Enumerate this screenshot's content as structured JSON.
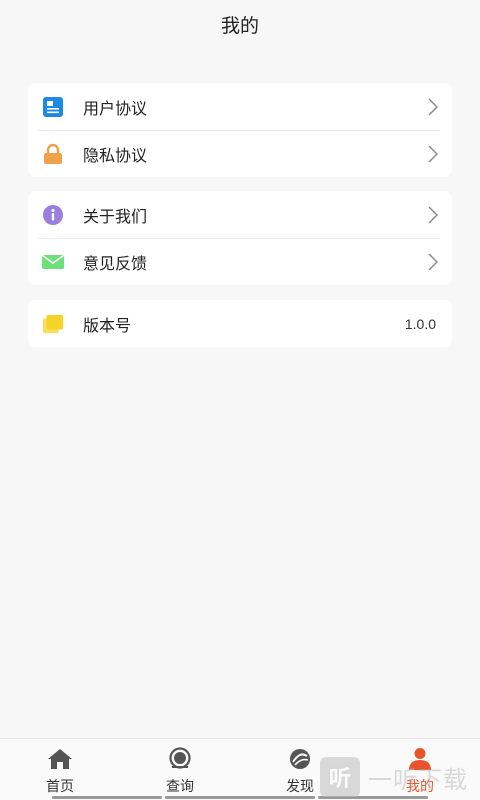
{
  "header": {
    "title": "我的"
  },
  "groups": [
    {
      "items": [
        {
          "label": "用户协议",
          "icon": "user-agreement-icon",
          "color": "#1e88e5"
        },
        {
          "label": "隐私协议",
          "icon": "lock-icon",
          "color": "#f0a24a"
        }
      ]
    },
    {
      "items": [
        {
          "label": "关于我们",
          "icon": "info-icon",
          "color": "#9b7fe0"
        },
        {
          "label": "意见反馈",
          "icon": "mail-icon",
          "color": "#6ee07a"
        }
      ]
    },
    {
      "items": [
        {
          "label": "版本号",
          "icon": "version-icon",
          "color": "#f5d327",
          "value": "1.0.0"
        }
      ]
    }
  ],
  "tabbar": {
    "tabs": [
      {
        "label": "首页",
        "icon": "home-icon"
      },
      {
        "label": "查询",
        "icon": "search-icon"
      },
      {
        "label": "发现",
        "icon": "discover-icon"
      },
      {
        "label": "我的",
        "icon": "profile-icon",
        "active": true
      }
    ]
  },
  "colors": {
    "accent": "#e8542c",
    "background": "#f7f7f7"
  },
  "watermark": {
    "text": "一听下载",
    "badge": "听"
  }
}
